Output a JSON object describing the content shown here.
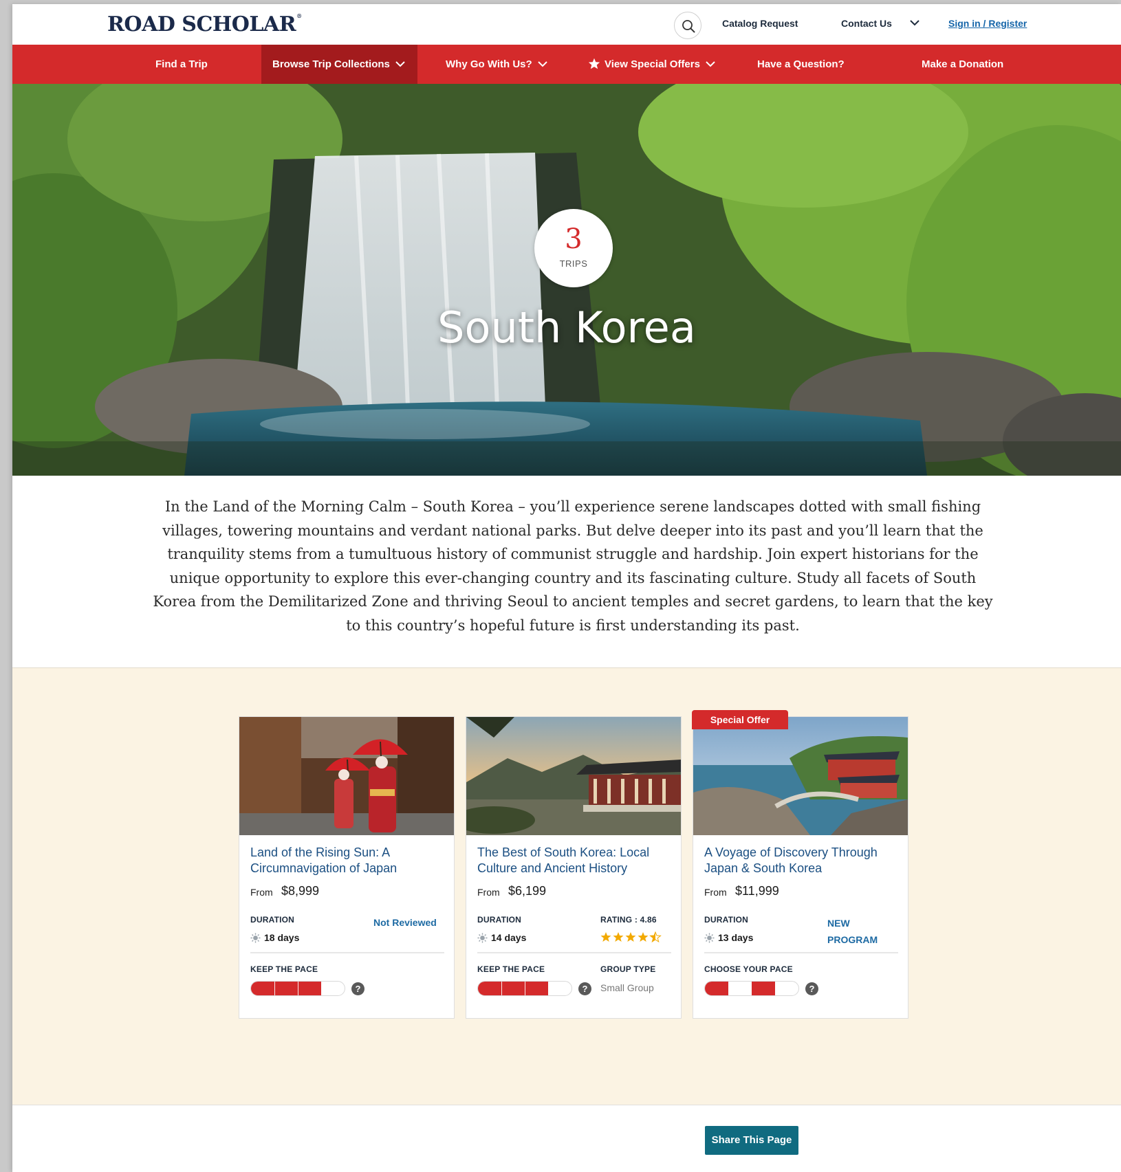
{
  "header": {
    "logo": "ROAD SCHOLAR",
    "logo_mark": "®",
    "catalog_request": "Catalog Request",
    "contact_us": "Contact Us",
    "sign_in": "Sign in / Register"
  },
  "nav": {
    "items": [
      {
        "label": "Find a Trip"
      },
      {
        "label": "Browse Trip Collections"
      },
      {
        "label": "Why Go With Us?"
      },
      {
        "label": "View Special Offers"
      },
      {
        "label": "Have a Question?"
      },
      {
        "label": "Make a Donation"
      }
    ],
    "active": "Browse Trip Collections"
  },
  "hero": {
    "trip_count": "3",
    "trip_count_label": "TRIPS",
    "title": "South Korea"
  },
  "intro": {
    "text": "In the Land of the Morning Calm – South Korea – you’ll experience serene landscapes dotted with small fishing villages, towering mountains and verdant national parks. But delve deeper into its past and you’ll learn that the tranquility stems from a tumultuous history of communist struggle and hardship. Join expert historians for the unique opportunity to explore this ever-changing country and its fascinating culture. Study all facets of South Korea from the Demilitarized Zone and thriving Seoul to ancient temples and secret gardens, to learn that the key to this country’s hopeful future is first understanding its past."
  },
  "cards": [
    {
      "title": "Land of the Rising Sun: A Circumnavigation of Japan",
      "price_from": "From",
      "price": "$8,999",
      "duration_label": "DURATION",
      "duration": "18 days",
      "status": "Not Reviewed",
      "pace_label": "KEEP THE PACE",
      "pace_level": 3,
      "pace_max": 4
    },
    {
      "title": "The Best of South Korea: Local Culture and Ancient History",
      "price_from": "From",
      "price": "$6,199",
      "duration_label": "DURATION",
      "duration": "14 days",
      "rating_label": "RATING : 4.86",
      "rating": 4.86,
      "pace_label": "KEEP THE PACE",
      "pace_level": 3,
      "pace_max": 4,
      "group_label": "GROUP TYPE",
      "group": "Small Group"
    },
    {
      "offer_tag": "Special Offer",
      "title": "A Voyage of Discovery Through Japan & South Korea",
      "price_from": "From",
      "price": "$11,999",
      "duration_label": "DURATION",
      "duration": "13 days",
      "status_line1": "NEW",
      "status_line2": "PROGRAM",
      "pace_label": "CHOOSE YOUR PACE"
    }
  ],
  "share": {
    "label": "Share This Page"
  },
  "colors": {
    "brand_red": "#d42a2b",
    "nav_active": "#a31b1d",
    "link_blue": "#1565a9",
    "share_teal": "#106b80",
    "section_bg": "#fbf3e3"
  }
}
